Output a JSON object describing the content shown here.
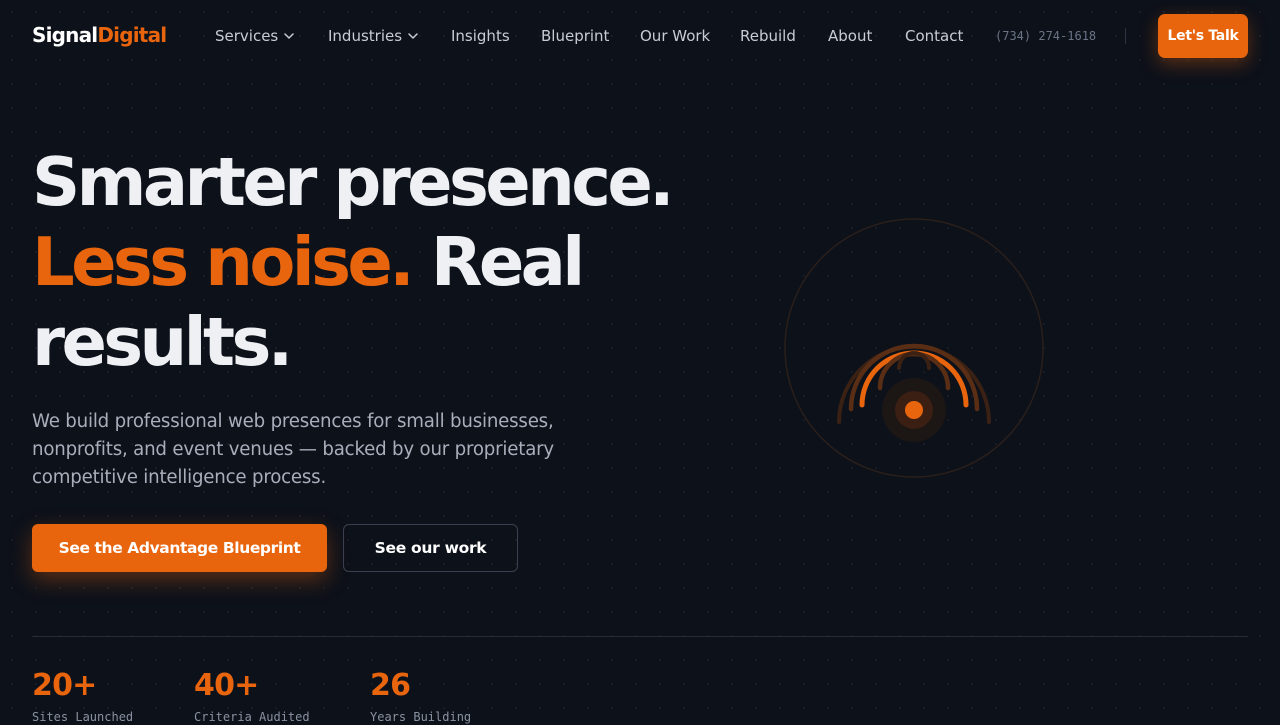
{
  "brand": {
    "part1": "Signal",
    "part2": "Digital"
  },
  "nav": {
    "items": [
      {
        "label": "Services"
      },
      {
        "label": "Industries"
      },
      {
        "label": "Insights"
      },
      {
        "label": "Blueprint"
      },
      {
        "label": "Our Work"
      },
      {
        "label": "Rebuild"
      },
      {
        "label": "About"
      },
      {
        "label": "Contact"
      }
    ],
    "phone": "(734) 274-1618",
    "cta": "Let's Talk"
  },
  "hero": {
    "line1": "Smarter presence.",
    "line2_accent": "Less noise.",
    "line2_rest": "Real",
    "line3": "results.",
    "lead": "We build professional web presences for small businesses, nonprofits, and event venues — backed by our proprietary competitive intelligence process.",
    "primary_button": "See the Advantage Blueprint",
    "secondary_button": "See our work"
  },
  "stats": [
    {
      "value": "20+",
      "label": "Sites Launched"
    },
    {
      "value": "40+",
      "label": "Criteria Audited"
    },
    {
      "value": "26",
      "label": "Years Building"
    }
  ],
  "colors": {
    "accent": "#e8650e",
    "background": "#0d111a",
    "text": "#eef0f4",
    "muted": "#a9aebb"
  },
  "icons": {
    "nav_dropdown": "chevron-down-icon",
    "hero_graphic": "signal-broadcast-icon"
  }
}
